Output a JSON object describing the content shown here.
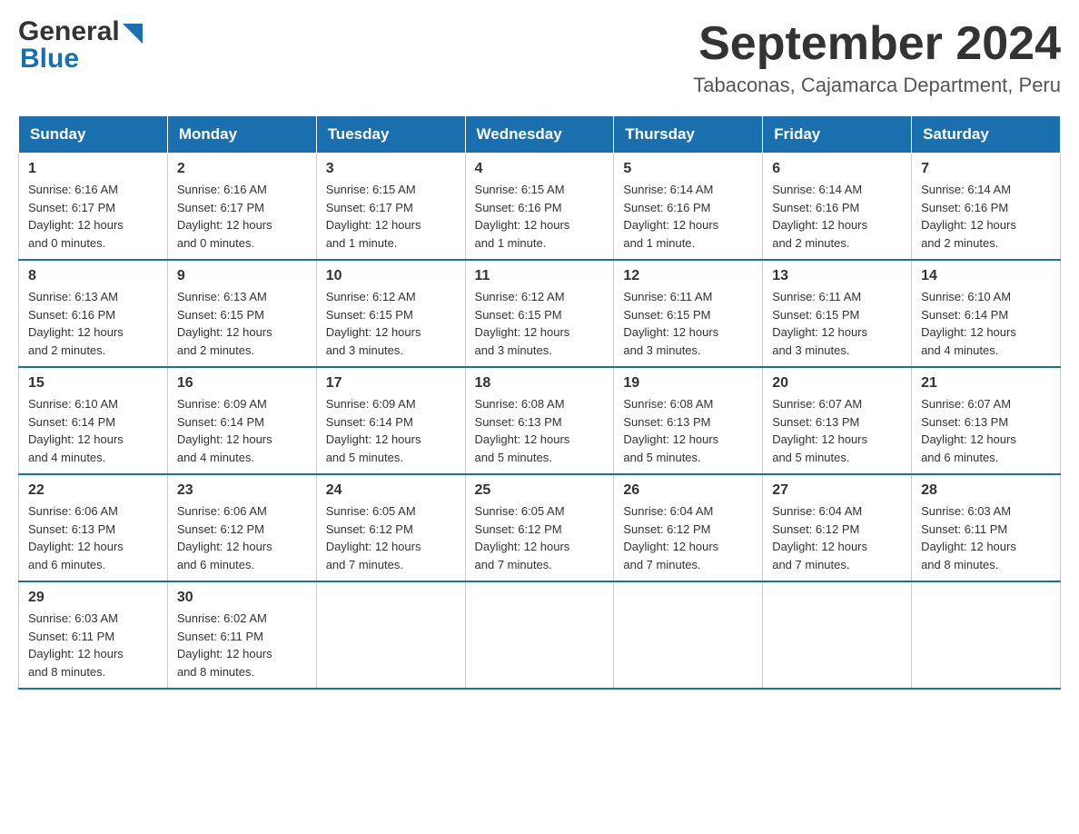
{
  "header": {
    "logo": {
      "text_general": "General",
      "text_blue": "Blue"
    },
    "title": "September 2024",
    "location": "Tabaconas, Cajamarca Department, Peru"
  },
  "calendar": {
    "days_of_week": [
      "Sunday",
      "Monday",
      "Tuesday",
      "Wednesday",
      "Thursday",
      "Friday",
      "Saturday"
    ],
    "weeks": [
      [
        {
          "day": "1",
          "sunrise": "6:16 AM",
          "sunset": "6:17 PM",
          "daylight": "12 hours and 0 minutes."
        },
        {
          "day": "2",
          "sunrise": "6:16 AM",
          "sunset": "6:17 PM",
          "daylight": "12 hours and 0 minutes."
        },
        {
          "day": "3",
          "sunrise": "6:15 AM",
          "sunset": "6:17 PM",
          "daylight": "12 hours and 1 minute."
        },
        {
          "day": "4",
          "sunrise": "6:15 AM",
          "sunset": "6:16 PM",
          "daylight": "12 hours and 1 minute."
        },
        {
          "day": "5",
          "sunrise": "6:14 AM",
          "sunset": "6:16 PM",
          "daylight": "12 hours and 1 minute."
        },
        {
          "day": "6",
          "sunrise": "6:14 AM",
          "sunset": "6:16 PM",
          "daylight": "12 hours and 2 minutes."
        },
        {
          "day": "7",
          "sunrise": "6:14 AM",
          "sunset": "6:16 PM",
          "daylight": "12 hours and 2 minutes."
        }
      ],
      [
        {
          "day": "8",
          "sunrise": "6:13 AM",
          "sunset": "6:16 PM",
          "daylight": "12 hours and 2 minutes."
        },
        {
          "day": "9",
          "sunrise": "6:13 AM",
          "sunset": "6:15 PM",
          "daylight": "12 hours and 2 minutes."
        },
        {
          "day": "10",
          "sunrise": "6:12 AM",
          "sunset": "6:15 PM",
          "daylight": "12 hours and 3 minutes."
        },
        {
          "day": "11",
          "sunrise": "6:12 AM",
          "sunset": "6:15 PM",
          "daylight": "12 hours and 3 minutes."
        },
        {
          "day": "12",
          "sunrise": "6:11 AM",
          "sunset": "6:15 PM",
          "daylight": "12 hours and 3 minutes."
        },
        {
          "day": "13",
          "sunrise": "6:11 AM",
          "sunset": "6:15 PM",
          "daylight": "12 hours and 3 minutes."
        },
        {
          "day": "14",
          "sunrise": "6:10 AM",
          "sunset": "6:14 PM",
          "daylight": "12 hours and 4 minutes."
        }
      ],
      [
        {
          "day": "15",
          "sunrise": "6:10 AM",
          "sunset": "6:14 PM",
          "daylight": "12 hours and 4 minutes."
        },
        {
          "day": "16",
          "sunrise": "6:09 AM",
          "sunset": "6:14 PM",
          "daylight": "12 hours and 4 minutes."
        },
        {
          "day": "17",
          "sunrise": "6:09 AM",
          "sunset": "6:14 PM",
          "daylight": "12 hours and 5 minutes."
        },
        {
          "day": "18",
          "sunrise": "6:08 AM",
          "sunset": "6:13 PM",
          "daylight": "12 hours and 5 minutes."
        },
        {
          "day": "19",
          "sunrise": "6:08 AM",
          "sunset": "6:13 PM",
          "daylight": "12 hours and 5 minutes."
        },
        {
          "day": "20",
          "sunrise": "6:07 AM",
          "sunset": "6:13 PM",
          "daylight": "12 hours and 5 minutes."
        },
        {
          "day": "21",
          "sunrise": "6:07 AM",
          "sunset": "6:13 PM",
          "daylight": "12 hours and 6 minutes."
        }
      ],
      [
        {
          "day": "22",
          "sunrise": "6:06 AM",
          "sunset": "6:13 PM",
          "daylight": "12 hours and 6 minutes."
        },
        {
          "day": "23",
          "sunrise": "6:06 AM",
          "sunset": "6:12 PM",
          "daylight": "12 hours and 6 minutes."
        },
        {
          "day": "24",
          "sunrise": "6:05 AM",
          "sunset": "6:12 PM",
          "daylight": "12 hours and 7 minutes."
        },
        {
          "day": "25",
          "sunrise": "6:05 AM",
          "sunset": "6:12 PM",
          "daylight": "12 hours and 7 minutes."
        },
        {
          "day": "26",
          "sunrise": "6:04 AM",
          "sunset": "6:12 PM",
          "daylight": "12 hours and 7 minutes."
        },
        {
          "day": "27",
          "sunrise": "6:04 AM",
          "sunset": "6:12 PM",
          "daylight": "12 hours and 7 minutes."
        },
        {
          "day": "28",
          "sunrise": "6:03 AM",
          "sunset": "6:11 PM",
          "daylight": "12 hours and 8 minutes."
        }
      ],
      [
        {
          "day": "29",
          "sunrise": "6:03 AM",
          "sunset": "6:11 PM",
          "daylight": "12 hours and 8 minutes."
        },
        {
          "day": "30",
          "sunrise": "6:02 AM",
          "sunset": "6:11 PM",
          "daylight": "12 hours and 8 minutes."
        },
        null,
        null,
        null,
        null,
        null
      ]
    ],
    "labels": {
      "sunrise": "Sunrise:",
      "sunset": "Sunset:",
      "daylight": "Daylight:"
    }
  }
}
